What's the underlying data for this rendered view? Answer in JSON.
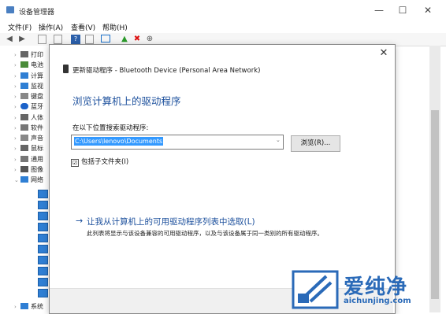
{
  "window": {
    "title": "设备管理器",
    "min_glyph": "—",
    "max_glyph": "☐",
    "close_glyph": "✕"
  },
  "menu": [
    "文件(F)",
    "操作(A)",
    "查看(V)",
    "帮助(H)"
  ],
  "tree": {
    "items": [
      {
        "label": "打印",
        "icon": "printer-icon"
      },
      {
        "label": "电池",
        "icon": "battery-icon"
      },
      {
        "label": "计算",
        "icon": "computer-icon"
      },
      {
        "label": "监视",
        "icon": "monitor-icon"
      },
      {
        "label": "键盘",
        "icon": "keyboard-icon"
      },
      {
        "label": "蓝牙",
        "icon": "bluetooth-icon"
      },
      {
        "label": "人体",
        "icon": "hid-icon"
      },
      {
        "label": "软件",
        "icon": "software-icon"
      },
      {
        "label": "声音",
        "icon": "audio-icon"
      },
      {
        "label": "鼠标",
        "icon": "mouse-icon"
      },
      {
        "label": "通用",
        "icon": "usb-icon"
      },
      {
        "label": "图像",
        "icon": "camera-icon"
      },
      {
        "label": "网络",
        "icon": "network-icon"
      }
    ],
    "bottom_item": "系统"
  },
  "dialog": {
    "close_glyph": "✕",
    "header": "更新驱动程序 - Bluetooth Device (Personal Area Network)",
    "title": "浏览计算机上的驱动程序",
    "search_label": "在以下位置搜索驱动程序:",
    "path_value": "C:\\Users\\lenovo\\Documents",
    "browse_label": "浏览(R)...",
    "include_subfolders": "包括子文件夹(I)",
    "checkbox_glyph": "☑",
    "pick_arrow": "→",
    "pick_link": "让我从计算机上的可用驱动程序列表中选取(L)",
    "pick_desc": "此列表将显示与该设备兼容的可用驱动程序，以及与该设备属于同一类别的所有驱动程序。"
  },
  "watermark": {
    "text": "爱纯净",
    "url": "aichunjing.com"
  }
}
